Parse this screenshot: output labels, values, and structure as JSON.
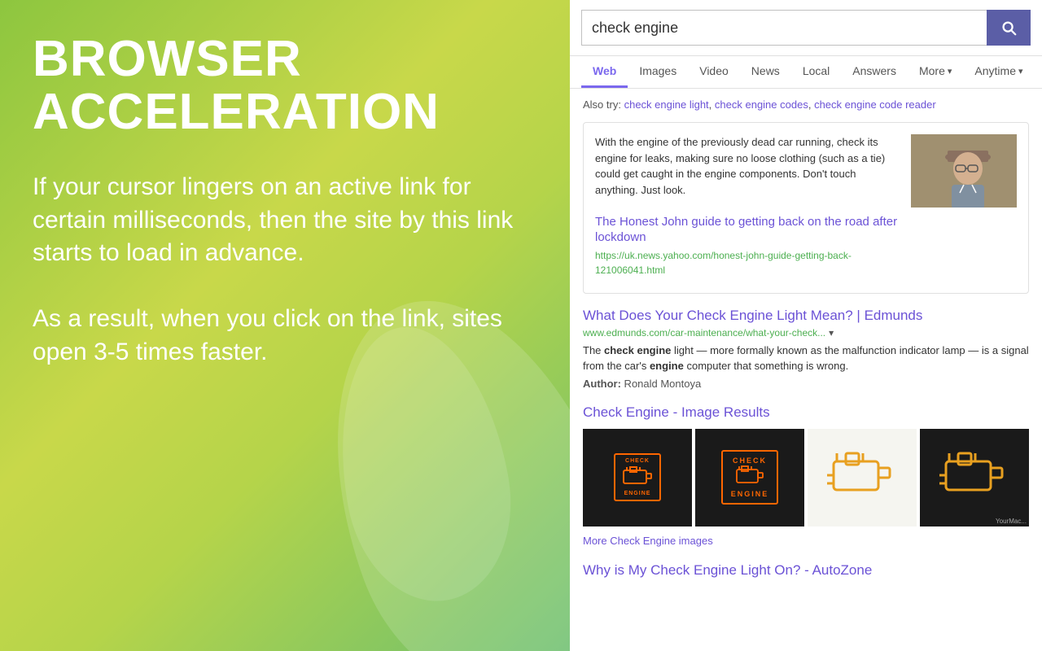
{
  "left": {
    "title_line1": "BROWSER",
    "title_line2": "ACCELERATION",
    "description": "If your cursor lingers on an active link for certain milliseconds, then the site by this link starts to load in advance.\nAs a result, when you click on the link, sites open 3-5 times faster."
  },
  "search": {
    "query": "check engine",
    "button_label": "Search",
    "tabs": [
      {
        "label": "Web",
        "active": true
      },
      {
        "label": "Images",
        "active": false
      },
      {
        "label": "Video",
        "active": false
      },
      {
        "label": "News",
        "active": false
      },
      {
        "label": "Local",
        "active": false
      },
      {
        "label": "Answers",
        "active": false
      },
      {
        "label": "More",
        "active": false,
        "dropdown": true
      },
      {
        "label": "Anytime",
        "active": false,
        "dropdown": true
      }
    ]
  },
  "results": {
    "also_try_label": "Also try:",
    "also_try_links": [
      "check engine light",
      "check engine codes",
      "check engine code reader"
    ],
    "card_result": {
      "text": "With the engine of the previously dead car running, check its engine for leaks, making sure no loose clothing (such as a tie) could get caught in the engine components. Don't touch anything. Just look.",
      "title": "The Honest John guide to getting back on the road after lockdown",
      "url": "https://uk.news.yahoo.com/honest-john-guide-getting-back-121006041.html"
    },
    "results": [
      {
        "title": "What Does Your Check Engine Light Mean? | Edmunds",
        "url": "www.edmunds.com/car-maintenance/what-your-check...",
        "has_dropdown": true,
        "desc_parts": [
          {
            "text": "The ",
            "bold": false
          },
          {
            "text": "check engine",
            "bold": true
          },
          {
            "text": " light — more formally known as the malfunction indicator lamp — is a signal from the car's ",
            "bold": false
          },
          {
            "text": "engine",
            "bold": true
          },
          {
            "text": " computer that something is wrong.",
            "bold": false
          }
        ],
        "author": "Ronald Montoya"
      }
    ],
    "image_section": {
      "title": "Check Engine - Image Results",
      "more_link": "More Check Engine images",
      "images": [
        {
          "type": "check-engine-orange-box",
          "bg": "dark"
        },
        {
          "type": "check-engine-orange-text",
          "bg": "dark"
        },
        {
          "type": "engine-outline-orange",
          "bg": "light"
        },
        {
          "type": "engine-outline-orange-dark",
          "bg": "dark"
        }
      ]
    },
    "bottom_result": {
      "title": "Why is My Check Engine Light On? - AutoZone",
      "partial": true
    }
  }
}
